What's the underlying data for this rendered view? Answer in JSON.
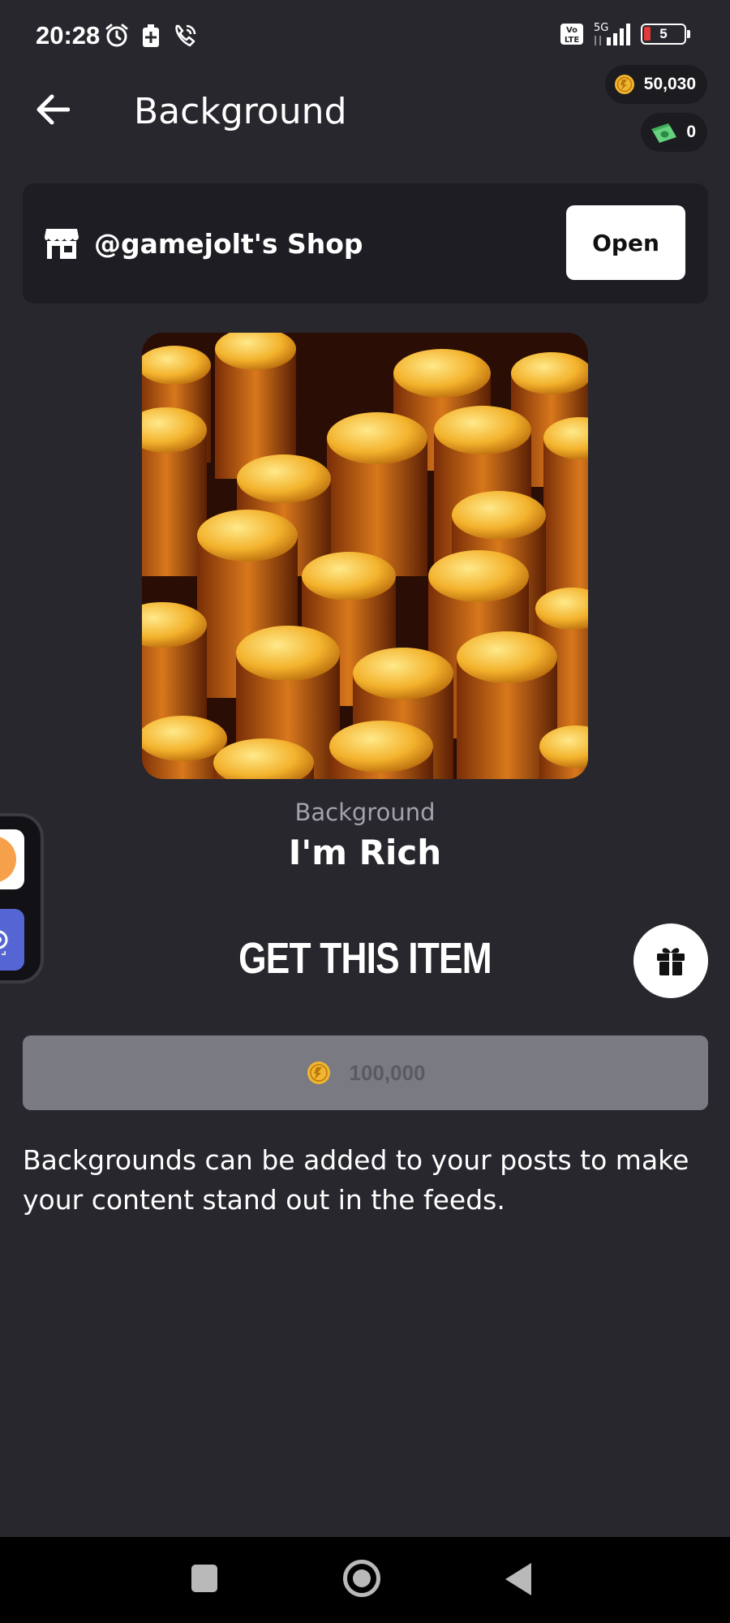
{
  "status_bar": {
    "time": "20:28",
    "network": "5G",
    "volte": "Vo LTE",
    "battery": "5",
    "icons_left": [
      "alarm-icon",
      "battery-saver-icon",
      "wifi-call-icon"
    ],
    "icons_right": [
      "volte-icon",
      "signal-icon",
      "battery-icon"
    ]
  },
  "header": {
    "title": "Background",
    "back_icon": "arrow-left-icon"
  },
  "wallet": {
    "coins": "50,030",
    "cash": "0"
  },
  "shop": {
    "name": "@gamejolt's Shop",
    "open_label": "Open",
    "icon": "storefront-icon"
  },
  "item": {
    "type": "Background",
    "name": "I'm Rich",
    "image_description_icon": "gold-coins-image"
  },
  "purchase": {
    "title": "GET THIS ITEM",
    "price": "100,000",
    "gift_icon": "gift-icon"
  },
  "description": "Backgrounds can be added to your posts to make your content stand out in the feeds.",
  "nav_bar": {
    "items": [
      "recents-icon",
      "home-icon",
      "back-icon"
    ]
  },
  "colors": {
    "background": "#28272d",
    "card": "#1e1d23",
    "coin": "#f2b531",
    "buy_button": "#7a7b82",
    "muted_text": "#a3a1aa"
  }
}
